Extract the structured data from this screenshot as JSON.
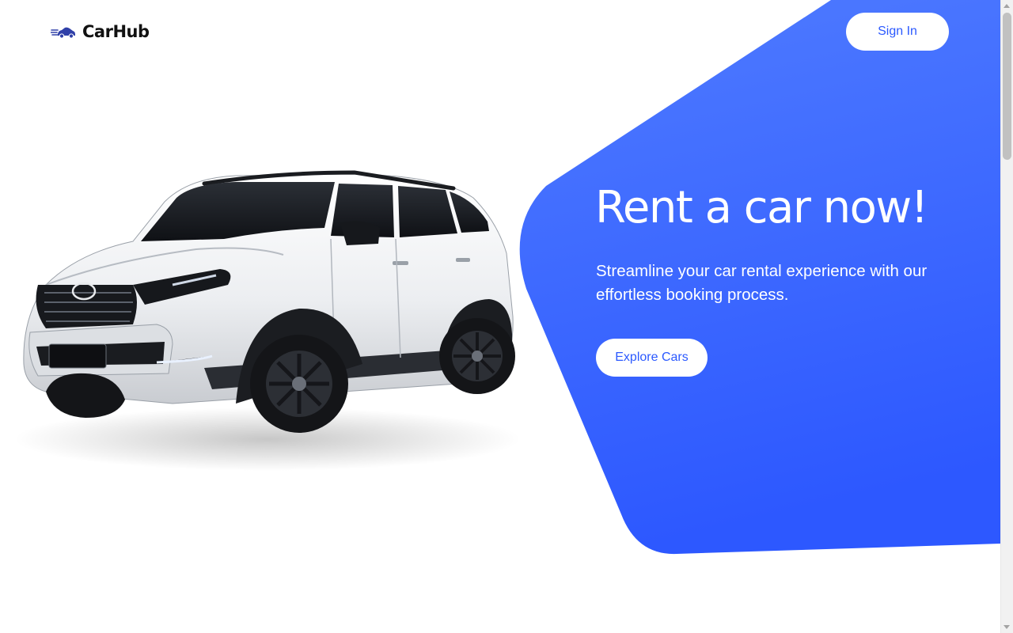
{
  "header": {
    "brand": "CarHub",
    "brand_icon": "car-logo-icon",
    "signin_label": "Sign In"
  },
  "hero": {
    "title": "Rent a car now!",
    "subtitle": "Streamline your car rental experience with our effortless booking process.",
    "cta_label": "Explore Cars",
    "image": "white-suv-car-image"
  },
  "colors": {
    "accent": "#2b59ff",
    "hero_gradient_top": "#4a76ff",
    "hero_gradient_bottom": "#2f5bff"
  }
}
